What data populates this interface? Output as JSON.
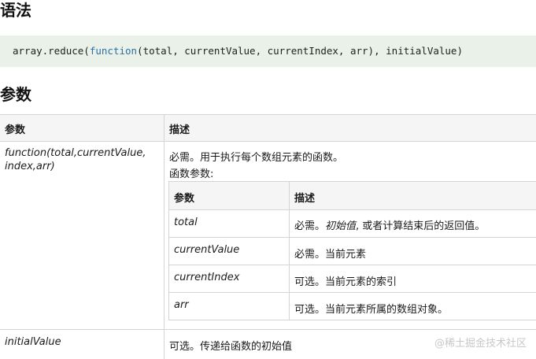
{
  "syntax_heading": "语法",
  "code": {
    "before": "array.reduce(",
    "keyword": "function",
    "after": "(total, currentValue, currentIndex, arr), initialValue)",
    "keyword_color": "#2c6fa3",
    "background": "#e9f1e8"
  },
  "params_heading": "参数",
  "table": {
    "col_param": "参数",
    "col_desc": "描述",
    "row1": {
      "param_line1": "function(total,currentValue,",
      "param_line2": "index,arr)",
      "desc_line1": "必需。用于执行每个数组元素的函数。",
      "desc_line2": "函数参数:",
      "inner": {
        "col_param": "参数",
        "col_desc": "描述",
        "rows": [
          {
            "param": "total",
            "desc_pre": "必需。",
            "desc_italic": "初始值",
            "desc_post": ", 或者计算结束后的返回值。"
          },
          {
            "param": "currentValue",
            "desc": "必需。当前元素"
          },
          {
            "param": "currentIndex",
            "desc": "可选。当前元素的索引"
          },
          {
            "param": "arr",
            "desc": "可选。当前元素所属的数组对象。"
          }
        ]
      }
    },
    "row2": {
      "param": "initialValue",
      "desc": "可选。传递给函数的初始值"
    },
    "header_bg": "#f5f5f5",
    "border_color": "#d4d4d4"
  },
  "watermark": "@稀土掘金技术社区"
}
